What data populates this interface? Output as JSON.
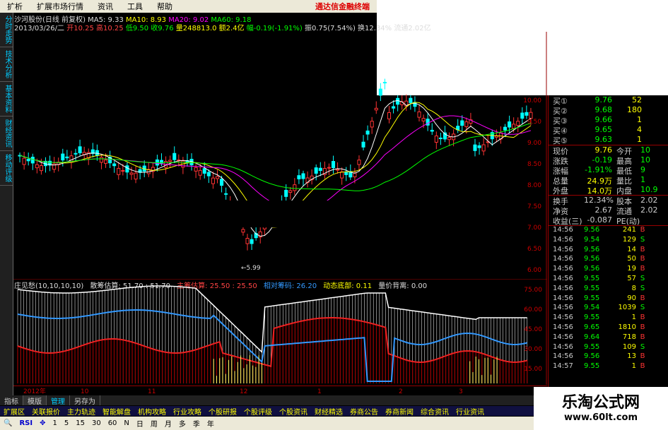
{
  "menu": {
    "items": [
      "扩析",
      "扩展市场行情",
      "资讯",
      "工具",
      "帮助"
    ],
    "ad": "通达信金融终端"
  },
  "left_tabs": [
    "分时走势",
    "技术分析",
    "基本资料",
    "财经资讯",
    "移动评级"
  ],
  "info1": {
    "name": "沙河股份(日线 前复权)",
    "ma5": "MA5: 9.33",
    "ma10": "MA10: 8.93",
    "ma20": "MA20: 9.02",
    "ma60": "MA60: 9.18"
  },
  "info2": {
    "date": "2013/03/26/二",
    "open": "开10.25",
    "high": "高10.25",
    "low": "低9.50",
    "close": "收9.76",
    "vol": "量248813.0",
    "amt": "额2.4亿",
    "chg": "幅-0.19(-1.91%)",
    "amp": "振0.75(7.54%)",
    "turn": "换12.34%",
    "flow": "流通2.02亿"
  },
  "price_axis": [
    "10.00",
    "9.50",
    "9.00",
    "8.50",
    "8.00",
    "7.50",
    "7.00",
    "6.50",
    "6.00"
  ],
  "low_marker": "←5.99",
  "indicator": {
    "name": "庄见愁(10,10,10,10)",
    "a": "散筹估算: 51.70 : 51.70",
    "b": "主筹估算: 25.50 : 25.50",
    "c": "相对筹码: 26.20",
    "d": "动态底部: 0.11",
    "e": "量价背离: 0.00"
  },
  "ind_axis": [
    "75.00",
    "60.00",
    "45.00",
    "30.00",
    "15.00"
  ],
  "time_axis": [
    "2012年",
    "10",
    "11",
    "12",
    "1",
    "2",
    "3"
  ],
  "bottom1": [
    "指标",
    "模版",
    "管理",
    "另存为"
  ],
  "bottom2": [
    "扩展区",
    "关联报价",
    "主力轨迹",
    "智能解盘",
    "机构攻略",
    "行业攻略",
    "个股研报",
    "个股评级",
    "个股资讯",
    "财经精选",
    "券商公告",
    "券商新闻",
    "综合资讯",
    "行业资讯"
  ],
  "bottom3": [
    "RSI",
    "1",
    "5",
    "15",
    "30",
    "60",
    "N",
    "日",
    "周",
    "月",
    "多",
    "季",
    "年"
  ],
  "buy_orders": [
    {
      "label": "买①",
      "price": "9.76",
      "qty": "52"
    },
    {
      "label": "买②",
      "price": "9.68",
      "qty": "180"
    },
    {
      "label": "买③",
      "price": "9.66",
      "qty": "1"
    },
    {
      "label": "买④",
      "price": "9.65",
      "qty": "4"
    },
    {
      "label": "买⑤",
      "price": "9.63",
      "qty": "1"
    }
  ],
  "stats": [
    {
      "k1": "现价",
      "v1": "9.76",
      "k2": "今开",
      "v2": "10"
    },
    {
      "k1": "涨跌",
      "v1": "-0.19",
      "k2": "最高",
      "v2": "10"
    },
    {
      "k1": "涨幅",
      "v1": "-1.91%",
      "k2": "最低",
      "v2": "9"
    },
    {
      "k1": "总量",
      "v1": "24.9万",
      "k2": "量比",
      "v2": "1"
    },
    {
      "k1": "外盘",
      "v1": "14.0万",
      "k2": "内盘",
      "v2": "10.9"
    }
  ],
  "stats2": [
    {
      "k1": "换手",
      "v1": "12.34%",
      "k2": "股本",
      "v2": "2.02"
    },
    {
      "k1": "净资",
      "v1": "2.67",
      "k2": "流通",
      "v2": "2.02"
    },
    {
      "k1": "收益(三)",
      "v1": "-0.087",
      "k2": "PE(动)",
      "v2": ""
    }
  ],
  "trades": [
    {
      "t": "14:56",
      "p": "9.56",
      "q": "241",
      "s": "B"
    },
    {
      "t": "14:56",
      "p": "9.54",
      "q": "129",
      "s": "S"
    },
    {
      "t": "14:56",
      "p": "9.56",
      "q": "14",
      "s": "B"
    },
    {
      "t": "14:56",
      "p": "9.56",
      "q": "50",
      "s": "B"
    },
    {
      "t": "14:56",
      "p": "9.56",
      "q": "19",
      "s": "B"
    },
    {
      "t": "14:56",
      "p": "9.55",
      "q": "57",
      "s": "S"
    },
    {
      "t": "14:56",
      "p": "9.55",
      "q": "8",
      "s": "S"
    },
    {
      "t": "14:56",
      "p": "9.55",
      "q": "90",
      "s": "B"
    },
    {
      "t": "14:56",
      "p": "9.54",
      "q": "1039",
      "s": "S"
    },
    {
      "t": "14:56",
      "p": "9.55",
      "q": "1",
      "s": "B"
    },
    {
      "t": "14:56",
      "p": "9.65",
      "q": "1810",
      "s": "B"
    },
    {
      "t": "14:56",
      "p": "9.64",
      "q": "718",
      "s": "B"
    },
    {
      "t": "14:56",
      "p": "9.55",
      "q": "109",
      "s": "S"
    },
    {
      "t": "14:56",
      "p": "9.56",
      "q": "13",
      "s": "B"
    },
    {
      "t": "14:57",
      "p": "9.55",
      "q": "1",
      "s": "B"
    }
  ],
  "logo": {
    "cn": "乐淘公式网",
    "url": "www.60lt.com"
  },
  "colors": {
    "up": "#ff3333",
    "down": "#00ffff",
    "ma5": "#ffffff",
    "ma10": "#ffff00",
    "ma20": "#ff00ff",
    "ma60": "#00ff00"
  }
}
